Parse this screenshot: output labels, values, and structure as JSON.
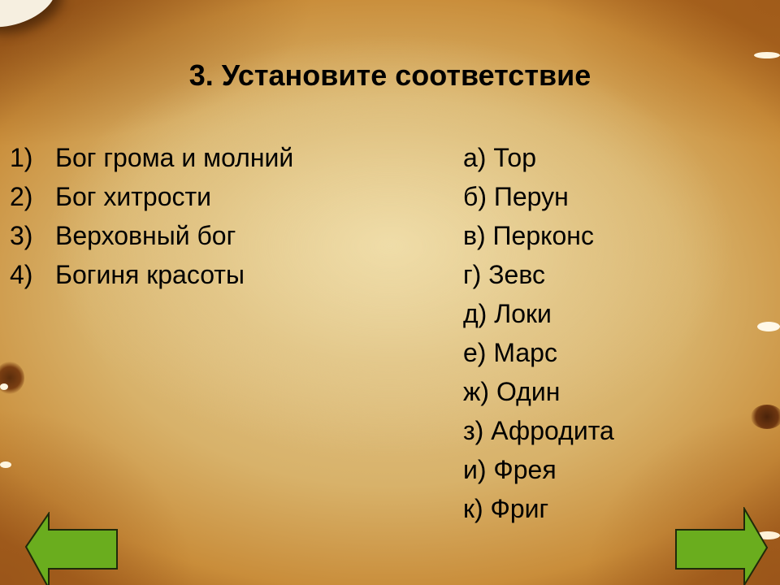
{
  "slide": {
    "title": "3. Установите соответствие",
    "left_items": [
      {
        "marker": "1)",
        "text": "Бог грома и молний"
      },
      {
        "marker": "2)",
        "text": "Бог хитрости"
      },
      {
        "marker": "3)",
        "text": "Верховный бог"
      },
      {
        "marker": "4)",
        "text": "Богиня красоты"
      }
    ],
    "right_items": [
      "а) Тор",
      "б) Перун",
      "в) Перконс",
      "г) Зевс",
      "д) Локи",
      "е) Марс",
      "ж) Один",
      "з) Афродита",
      "и) Фрея",
      "к) Фриг"
    ]
  },
  "navigation": {
    "prev_icon": "arrow-left-icon",
    "next_icon": "arrow-right-icon",
    "arrow_color": "#6aad1e",
    "arrow_outline": "#1f2a0a"
  }
}
